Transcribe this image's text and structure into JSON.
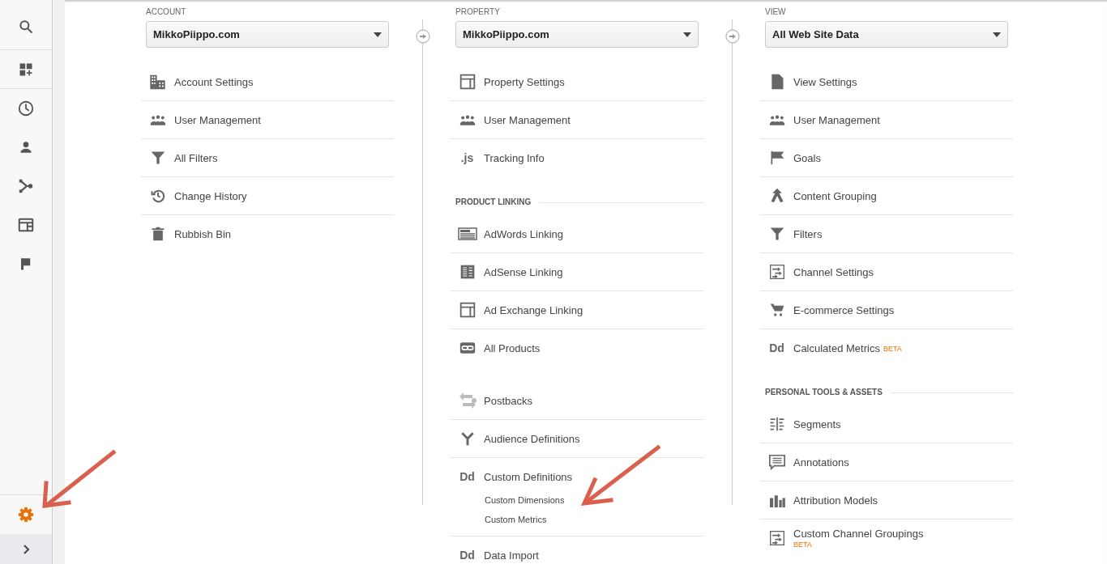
{
  "sidebar": {
    "items": [
      {
        "kind": "search"
      },
      {
        "kind": "customization"
      },
      {
        "kind": "realtime"
      },
      {
        "kind": "audience"
      },
      {
        "kind": "acquisition"
      },
      {
        "kind": "behavior"
      },
      {
        "kind": "conversions"
      }
    ],
    "admin": {
      "selected": true
    },
    "collapse_toggle": {
      "expanded": false
    }
  },
  "columns": [
    {
      "label": "ACCOUNT",
      "dropdown": {
        "value": "MikkoPiippo.com"
      },
      "sections": [
        {
          "items": [
            {
              "label": "Account Settings",
              "kind": "building"
            },
            {
              "label": "User Management",
              "kind": "people"
            },
            {
              "label": "All Filters",
              "kind": "filter"
            },
            {
              "label": "Change History",
              "kind": "history"
            },
            {
              "label": "Rubbish Bin",
              "kind": "trash"
            }
          ]
        }
      ]
    },
    {
      "label": "PROPERTY",
      "dropdown": {
        "value": "MikkoPiippo.com"
      },
      "sections": [
        {
          "items": [
            {
              "label": "Property Settings",
              "kind": "window"
            },
            {
              "label": "User Management",
              "kind": "people"
            },
            {
              "label": "Tracking Info",
              "kind": "glyph",
              "glyph": ".js"
            }
          ]
        },
        {
          "heading": "PRODUCT LINKING",
          "items": [
            {
              "label": "AdWords Linking",
              "kind": "adwords"
            },
            {
              "label": "AdSense Linking",
              "kind": "adsense"
            },
            {
              "label": "Ad Exchange Linking",
              "kind": "window"
            },
            {
              "label": "All Products",
              "kind": "link"
            }
          ]
        },
        {
          "items": [
            {
              "label": "Postbacks",
              "kind": "postbacks"
            },
            {
              "label": "Audience Definitions",
              "kind": "fork"
            },
            {
              "label": "Custom Definitions",
              "kind": "glyph",
              "glyph": "Dd",
              "children": [
                {
                  "label": "Custom Dimensions"
                },
                {
                  "label": "Custom Metrics"
                }
              ]
            },
            {
              "label": "Data Import",
              "kind": "glyph",
              "glyph": "Dd"
            }
          ]
        }
      ]
    },
    {
      "label": "VIEW",
      "dropdown": {
        "value": "All Web Site Data"
      },
      "sections": [
        {
          "items": [
            {
              "label": "View Settings",
              "kind": "document"
            },
            {
              "label": "User Management",
              "kind": "people"
            },
            {
              "label": "Goals",
              "kind": "flag"
            },
            {
              "label": "Content Grouping",
              "kind": "merge"
            },
            {
              "label": "Filters",
              "kind": "filter"
            },
            {
              "label": "Channel Settings",
              "kind": "channels"
            },
            {
              "label": "E-commerce Settings",
              "kind": "cart"
            },
            {
              "label": "Calculated Metrics",
              "kind": "glyph",
              "glyph": "Dd",
              "badge": "BETA",
              "badge_below": false
            }
          ]
        },
        {
          "heading": "PERSONAL TOOLS & ASSETS",
          "items": [
            {
              "label": "Segments",
              "kind": "segments"
            },
            {
              "label": "Annotations",
              "kind": "comment"
            },
            {
              "label": "Attribution Models",
              "kind": "bars"
            },
            {
              "label": "Custom Channel Groupings",
              "kind": "channels",
              "badge": "BETA",
              "badge_below": true
            }
          ]
        }
      ]
    }
  ]
}
